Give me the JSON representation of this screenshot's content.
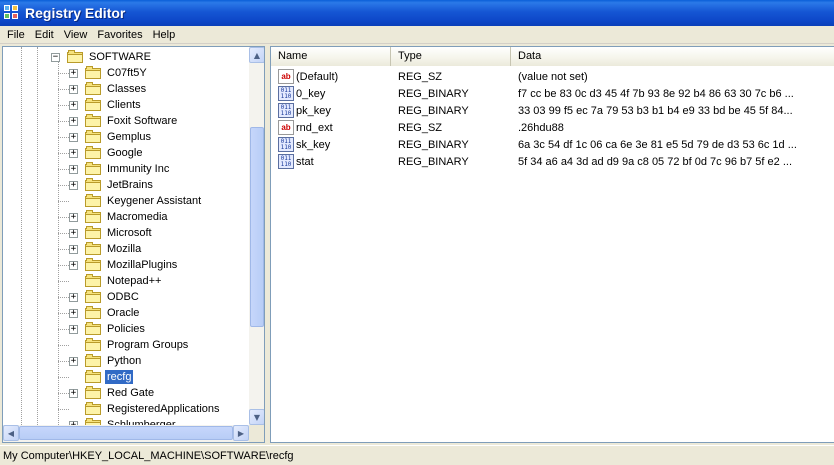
{
  "window": {
    "title": "Registry Editor"
  },
  "menu": [
    "File",
    "Edit",
    "View",
    "Favorites",
    "Help"
  ],
  "tree": {
    "parent": "SOFTWARE",
    "items": [
      {
        "label": "C07ft5Y",
        "expandable": true
      },
      {
        "label": "Classes",
        "expandable": true
      },
      {
        "label": "Clients",
        "expandable": true
      },
      {
        "label": "Foxit Software",
        "expandable": true
      },
      {
        "label": "Gemplus",
        "expandable": true
      },
      {
        "label": "Google",
        "expandable": true
      },
      {
        "label": "Immunity Inc",
        "expandable": true
      },
      {
        "label": "JetBrains",
        "expandable": true
      },
      {
        "label": "Keygener Assistant",
        "expandable": false
      },
      {
        "label": "Macromedia",
        "expandable": true
      },
      {
        "label": "Microsoft",
        "expandable": true
      },
      {
        "label": "Mozilla",
        "expandable": true
      },
      {
        "label": "MozillaPlugins",
        "expandable": true
      },
      {
        "label": "Notepad++",
        "expandable": false
      },
      {
        "label": "ODBC",
        "expandable": true
      },
      {
        "label": "Oracle",
        "expandable": true
      },
      {
        "label": "Policies",
        "expandable": true
      },
      {
        "label": "Program Groups",
        "expandable": false
      },
      {
        "label": "Python",
        "expandable": true
      },
      {
        "label": "recfg",
        "expandable": false,
        "selected": true
      },
      {
        "label": "Red Gate",
        "expandable": true
      },
      {
        "label": "RegisteredApplications",
        "expandable": false
      },
      {
        "label": "Schlumberger",
        "expandable": true
      }
    ]
  },
  "list": {
    "columns": [
      "Name",
      "Type",
      "Data"
    ],
    "rows": [
      {
        "icon": "string-value-icon",
        "name": "(Default)",
        "type": "REG_SZ",
        "data": "(value not set)"
      },
      {
        "icon": "binary-value-icon",
        "name": "0_key",
        "type": "REG_BINARY",
        "data": "f7 cc be 83 0c d3 45 4f 7b 93 8e 92 b4 86 63 30 7c b6 ..."
      },
      {
        "icon": "binary-value-icon",
        "name": "pk_key",
        "type": "REG_BINARY",
        "data": "33 03 99 f5 ec 7a 79 53 b3 b1 b4 e9 33 bd be 45 5f 84..."
      },
      {
        "icon": "string-value-icon",
        "name": "rnd_ext",
        "type": "REG_SZ",
        "data": ".26hdu88"
      },
      {
        "icon": "binary-value-icon",
        "name": "sk_key",
        "type": "REG_BINARY",
        "data": "6a 3c 54 df 1c 06 ca 6e 3e 81 e5 5d 79 de d3 53 6c 1d ..."
      },
      {
        "icon": "binary-value-icon",
        "name": "stat",
        "type": "REG_BINARY",
        "data": "5f 34 a6 a4 3d ad d9 9a c8 05 72 bf 0d 7c 96 b7 5f e2 ..."
      }
    ]
  },
  "status": {
    "path": "My Computer\\HKEY_LOCAL_MACHINE\\SOFTWARE\\recfg"
  },
  "icons": {
    "string": "ab",
    "binary": "011 110"
  }
}
